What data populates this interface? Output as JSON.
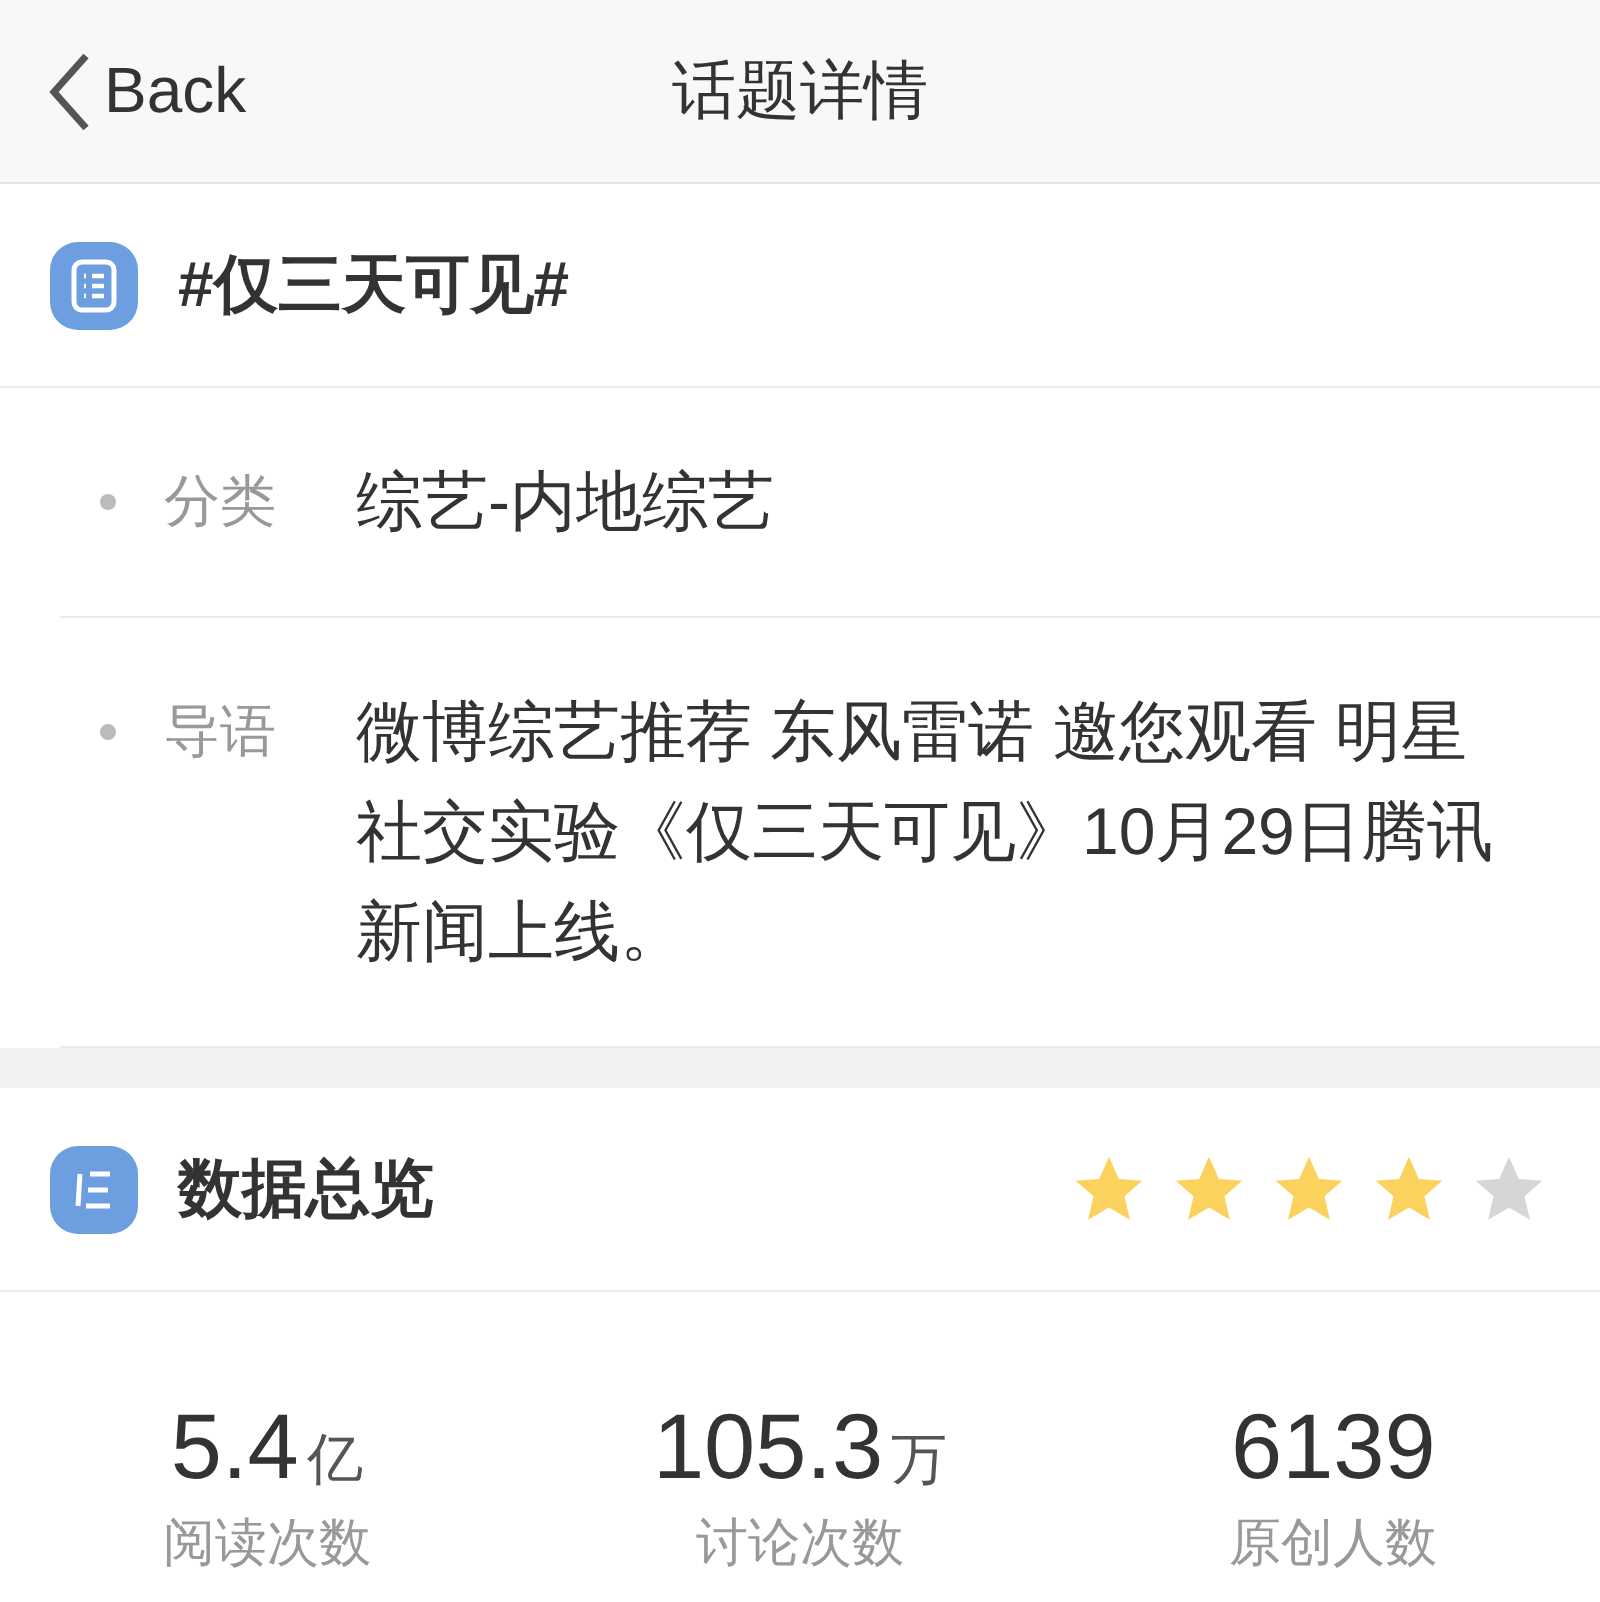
{
  "nav": {
    "back": "Back",
    "title": "话题详情"
  },
  "topic": {
    "title": "#仅三天可见#"
  },
  "details": [
    {
      "label": "分类",
      "value": "综艺-内地综艺"
    },
    {
      "label": "导语",
      "value": "微博综艺推荐 东风雷诺 邀您观看 明星社交实验《仅三天可见》10月29日腾讯新闻上线。"
    }
  ],
  "overview": {
    "title": "数据总览",
    "stars": 4,
    "stats": [
      {
        "value": "5.4",
        "unit": "亿",
        "label": "阅读次数"
      },
      {
        "value": "105.3",
        "unit": "万",
        "label": "讨论次数"
      },
      {
        "value": "6139",
        "label": "原创人数"
      }
    ]
  }
}
